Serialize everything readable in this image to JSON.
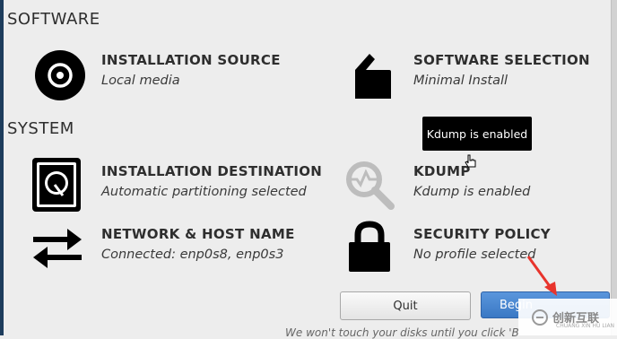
{
  "software_section": {
    "title": "SOFTWARE"
  },
  "system_section": {
    "title": "SYSTEM"
  },
  "spokes": {
    "installation_source": {
      "name": "INSTALLATION SOURCE",
      "status": "Local media",
      "icon": "disc-icon"
    },
    "software_selection": {
      "name": "SOFTWARE SELECTION",
      "status": "Minimal Install",
      "icon": "package-icon"
    },
    "installation_destination": {
      "name": "INSTALLATION DESTINATION",
      "status": "Automatic partitioning selected",
      "icon": "hard-drive-icon"
    },
    "kdump": {
      "name": "KDUMP",
      "status": "Kdump is enabled",
      "icon": "magnifier-icon"
    },
    "network": {
      "name": "NETWORK & HOST NAME",
      "status": "Connected: enp0s8, enp0s3",
      "icon": "network-arrows-icon"
    },
    "security_policy": {
      "name": "SECURITY POLICY",
      "status": "No profile selected",
      "icon": "lock-icon"
    }
  },
  "tooltip": {
    "text": "Kdump is enabled"
  },
  "buttons": {
    "quit": "Quit",
    "begin": "Begin"
  },
  "footnote": "We won't touch your disks until you click 'B",
  "watermark": {
    "text": "创新互联",
    "sub": "CHUANG XIN HU LIAN"
  },
  "colors": {
    "accent": "#3a78c4",
    "icon": "#000000",
    "tooltip_bg": "#000000",
    "background": "#ededed"
  }
}
